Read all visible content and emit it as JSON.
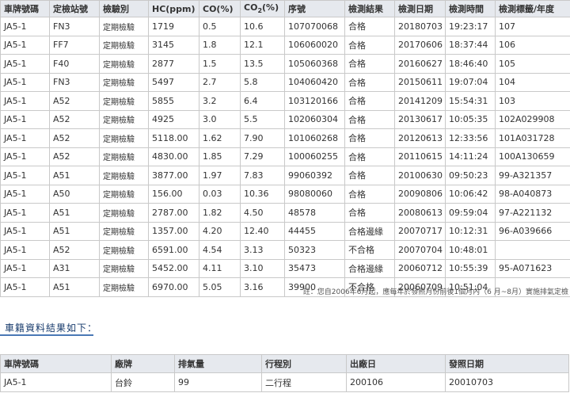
{
  "inspection": {
    "headers": {
      "plate": "車牌號碼",
      "station": "定檢站號",
      "category": "檢驗別",
      "hc": "HC(ppm)",
      "co": "CO(%)",
      "co2_prefix": "CO",
      "co2_sub": "2",
      "co2_suffix": "(%)",
      "serial": "序號",
      "result": "檢測結果",
      "date": "檢測日期",
      "time": "檢測時間",
      "label": "檢測標籤/年度"
    },
    "rows": [
      {
        "plate": "JA5-1",
        "station": "FN3",
        "category": "定期檢驗",
        "hc": "1719",
        "co": "0.5",
        "co2": "10.6",
        "serial": "107070068",
        "result": "合格",
        "date": "20180703",
        "time": "19:23:17",
        "label": "107"
      },
      {
        "plate": "JA5-1",
        "station": "FF7",
        "category": "定期檢驗",
        "hc": "3145",
        "co": "1.8",
        "co2": "12.1",
        "serial": "106060020",
        "result": "合格",
        "date": "20170606",
        "time": "18:37:44",
        "label": "106"
      },
      {
        "plate": "JA5-1",
        "station": "F40",
        "category": "定期檢驗",
        "hc": "2877",
        "co": "1.5",
        "co2": "13.5",
        "serial": "105060368",
        "result": "合格",
        "date": "20160627",
        "time": "18:46:40",
        "label": "105"
      },
      {
        "plate": "JA5-1",
        "station": "FN3",
        "category": "定期檢驗",
        "hc": "5497",
        "co": "2.7",
        "co2": "5.8",
        "serial": "104060420",
        "result": "合格",
        "date": "20150611",
        "time": "19:07:04",
        "label": "104"
      },
      {
        "plate": "JA5-1",
        "station": "A52",
        "category": "定期檢驗",
        "hc": "5855",
        "co": "3.2",
        "co2": "6.4",
        "serial": "103120166",
        "result": "合格",
        "date": "20141209",
        "time": "15:54:31",
        "label": "103"
      },
      {
        "plate": "JA5-1",
        "station": "A52",
        "category": "定期檢驗",
        "hc": "4925",
        "co": "3.0",
        "co2": "5.5",
        "serial": "102060304",
        "result": "合格",
        "date": "20130617",
        "time": "10:05:35",
        "label": "102A029908"
      },
      {
        "plate": "JA5-1",
        "station": "A52",
        "category": "定期檢驗",
        "hc": "5118.00",
        "co": "1.62",
        "co2": "7.90",
        "serial": "101060268",
        "result": "合格",
        "date": "20120613",
        "time": "12:33:56",
        "label": "101A031728"
      },
      {
        "plate": "JA5-1",
        "station": "A52",
        "category": "定期檢驗",
        "hc": "4830.00",
        "co": "1.85",
        "co2": "7.29",
        "serial": "100060255",
        "result": "合格",
        "date": "20110615",
        "time": "14:11:24",
        "label": "100A130659"
      },
      {
        "plate": "JA5-1",
        "station": "A51",
        "category": "定期檢驗",
        "hc": "3877.00",
        "co": "1.97",
        "co2": "7.83",
        "serial": "99060392",
        "result": "合格",
        "date": "20100630",
        "time": "09:50:23",
        "label": "99-A321357"
      },
      {
        "plate": "JA5-1",
        "station": "A50",
        "category": "定期檢驗",
        "hc": "156.00",
        "co": "0.03",
        "co2": "10.36",
        "serial": "98080060",
        "result": "合格",
        "date": "20090806",
        "time": "10:06:42",
        "label": "98-A040873"
      },
      {
        "plate": "JA5-1",
        "station": "A51",
        "category": "定期檢驗",
        "hc": "2787.00",
        "co": "1.82",
        "co2": "4.50",
        "serial": "48578",
        "result": "合格",
        "date": "20080613",
        "time": "09:59:04",
        "label": "97-A221132"
      },
      {
        "plate": "JA5-1",
        "station": "A51",
        "category": "定期檢驗",
        "hc": "1357.00",
        "co": "4.20",
        "co2": "12.40",
        "serial": "44455",
        "result": "合格邊緣",
        "date": "20070717",
        "time": "10:12:31",
        "label": "96-A039666"
      },
      {
        "plate": "JA5-1",
        "station": "A52",
        "category": "定期檢驗",
        "hc": "6591.00",
        "co": "4.54",
        "co2": "3.13",
        "serial": "50323",
        "result": "不合格",
        "date": "20070704",
        "time": "10:48:01",
        "label": ""
      },
      {
        "plate": "JA5-1",
        "station": "A31",
        "category": "定期檢驗",
        "hc": "5452.00",
        "co": "4.11",
        "co2": "3.10",
        "serial": "35473",
        "result": "合格邊緣",
        "date": "20060712",
        "time": "10:55:39",
        "label": "95-A071623"
      },
      {
        "plate": "JA5-1",
        "station": "A51",
        "category": "定期檢驗",
        "hc": "6970.00",
        "co": "5.05",
        "co2": "3.16",
        "serial": "39900",
        "result": "不合格",
        "date": "20060709",
        "time": "10:51:04",
        "label": ""
      }
    ],
    "note": "註：您自2006年6月起，應每年於發照月份前後1個月內（6 月~8月）實施排氣定檢"
  },
  "vehicle": {
    "title": "車籍資料結果如下：",
    "headers": {
      "plate": "車牌號碼",
      "brand": "廠牌",
      "displacement": "排氣量",
      "stroke": "行程別",
      "manufacture": "出廠日",
      "issue": "發照日期"
    },
    "row": {
      "plate": "JA5-1",
      "brand": "台鈴",
      "displacement": "99",
      "stroke": "二行程",
      "manufacture": "200106",
      "issue": "20010703"
    }
  },
  "colors": {
    "header_bg": "#e6e9ee",
    "border": "#c9c9c9",
    "title_text": "#1a3d6e",
    "title_underline": "#4a78b5"
  }
}
